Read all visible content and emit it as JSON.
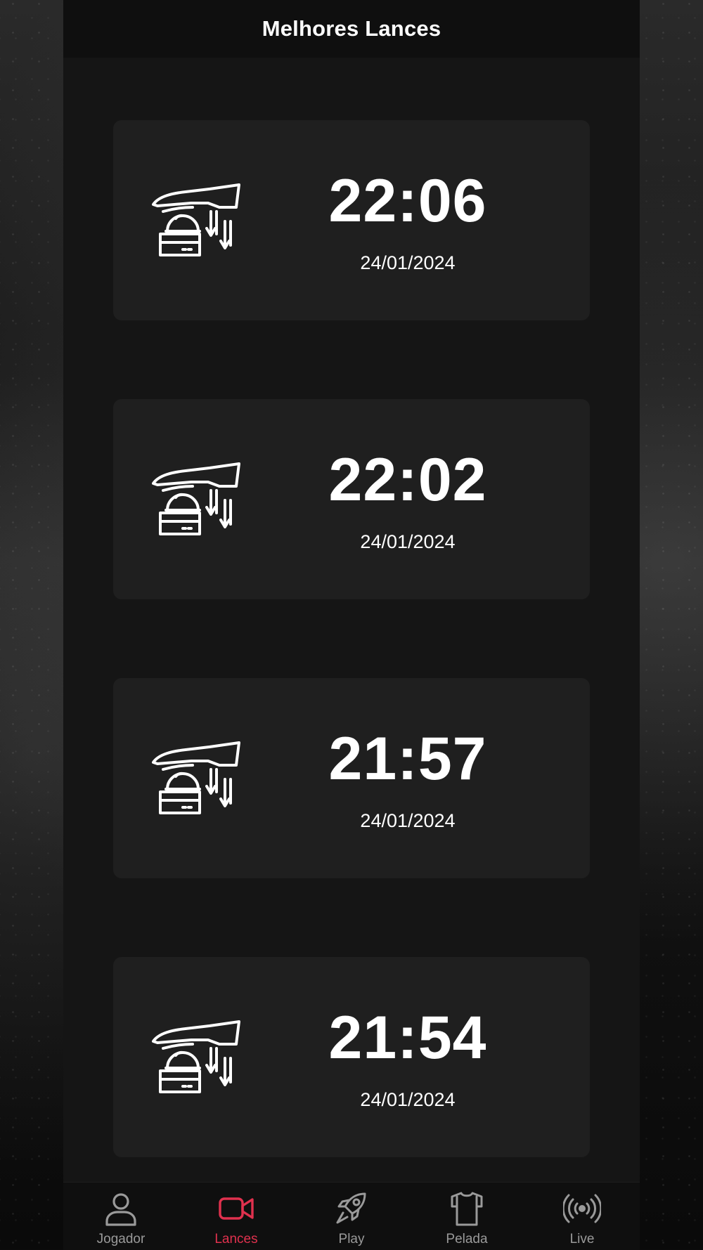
{
  "header": {
    "title": "Melhores Lances"
  },
  "highlights": [
    {
      "time": "22:06",
      "date": "24/01/2024",
      "icon": "press-button-icon"
    },
    {
      "time": "22:02",
      "date": "24/01/2024",
      "icon": "press-button-icon"
    },
    {
      "time": "21:57",
      "date": "24/01/2024",
      "icon": "press-button-icon"
    },
    {
      "time": "21:54",
      "date": "24/01/2024",
      "icon": "press-button-icon"
    }
  ],
  "tabbar": {
    "tabs": [
      {
        "label": "Jogador",
        "icon": "user-icon",
        "active": false
      },
      {
        "label": "Lances",
        "icon": "video-camera-icon",
        "active": true
      },
      {
        "label": "Play",
        "icon": "rocket-icon",
        "active": false
      },
      {
        "label": "Pelada",
        "icon": "tshirt-icon",
        "active": false
      },
      {
        "label": "Live",
        "icon": "broadcast-icon",
        "active": false
      }
    ]
  },
  "colors": {
    "accent": "#e0314e",
    "inactive": "#9a9a9a",
    "card": "#1f1f1f",
    "background": "#151515"
  }
}
